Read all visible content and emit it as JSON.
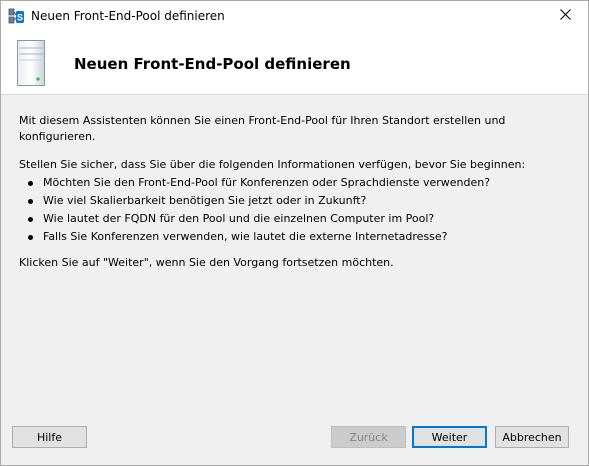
{
  "window": {
    "title": "Neuen Front-End-Pool definieren",
    "app_icon": "skype-topology-builder-icon",
    "close_icon": "close-icon"
  },
  "header": {
    "icon": "server-icon",
    "title": "Neuen Front-End-Pool definieren"
  },
  "content": {
    "intro": "Mit diesem Assistenten können Sie einen Front-End-Pool für Ihren Standort erstellen und konfigurieren.",
    "requirements_heading": "Stellen Sie sicher, dass Sie über die folgenden Informationen verfügen, bevor Sie beginnen:",
    "bullets": [
      "Möchten Sie den Front-End-Pool für Konferenzen oder Sprachdienste verwenden?",
      "Wie viel Skalierbarkeit benötigen Sie jetzt oder in Zukunft?",
      "Wie lautet der FQDN für den Pool und die einzelnen Computer im Pool?",
      "Falls Sie Konferenzen verwenden, wie lautet die externe Internetadresse?"
    ],
    "continue_hint": "Klicken Sie auf \"Weiter\", wenn Sie den Vorgang fortsetzen möchten."
  },
  "buttons": {
    "help": "Hilfe",
    "back": "Zurück",
    "next": "Weiter",
    "cancel": "Abbrechen"
  },
  "colors": {
    "dialog_background": "#f0f0f0",
    "header_background": "#ffffff",
    "default_button_border": "#0078d7",
    "disabled_text": "#838383"
  }
}
